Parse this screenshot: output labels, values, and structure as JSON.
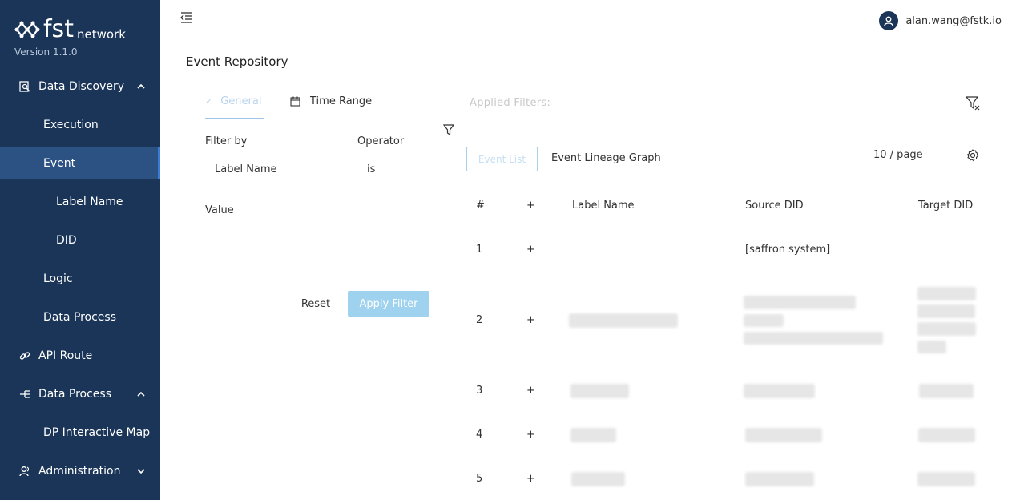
{
  "brand": {
    "logo_text": "fst",
    "logo_sub": "network",
    "version": "Version 1.1.0"
  },
  "sidebar": {
    "items": [
      {
        "label": "Data Discovery",
        "icon": "search-doc-icon",
        "expanded": true
      },
      {
        "label": "Execution"
      },
      {
        "label": "Event",
        "active": true
      },
      {
        "label": "Label Name"
      },
      {
        "label": "DID"
      },
      {
        "label": "Logic"
      },
      {
        "label": "Data Process"
      },
      {
        "label": "API Route",
        "icon": "link-icon"
      },
      {
        "label": "Data Process",
        "icon": "flow-icon",
        "expanded": true
      },
      {
        "label": "DP Interactive Map"
      },
      {
        "label": "Administration",
        "icon": "users-icon",
        "expanded": false
      }
    ]
  },
  "header": {
    "user_email": "alan.wang@fstk.io"
  },
  "page": {
    "title": "Event Repository"
  },
  "filter": {
    "tabs": {
      "general": "General",
      "time_range": "Time Range"
    },
    "filter_by_label": "Filter by",
    "operator_label": "Operator",
    "filter_by_value": "Label Name",
    "operator_value": "is",
    "value_label": "Value",
    "reset": "Reset",
    "apply": "Apply Filter"
  },
  "results": {
    "applied_filters": "Applied Filters:",
    "tab_event_list": "Event List",
    "tab_lineage": "Event Lineage Graph",
    "page_size": "10 / page",
    "columns": [
      "#",
      "+",
      "Label Name",
      "Source DID",
      "Target DID"
    ],
    "rows": [
      {
        "index": "1",
        "expand": "+",
        "source_did": "[saffron system]"
      },
      {
        "index": "2",
        "expand": "+"
      },
      {
        "index": "3",
        "expand": "+"
      },
      {
        "index": "4",
        "expand": "+"
      },
      {
        "index": "5",
        "expand": "+"
      }
    ]
  },
  "colors": {
    "sidebar": "#1a3558",
    "active": "#2c5283",
    "accent": "#9fd2ee"
  }
}
